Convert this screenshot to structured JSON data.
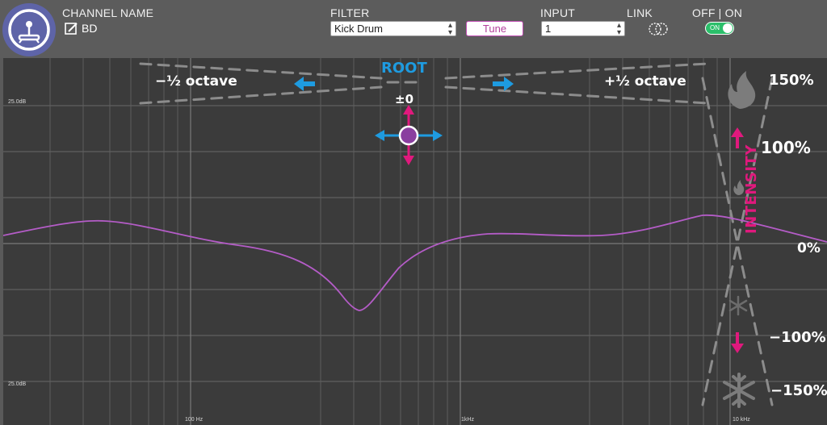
{
  "header": {
    "channel_name_label": "CHANNEL NAME",
    "channel_name_value": "BD",
    "filter_label": "FILTER",
    "filter_value": "Kick Drum",
    "tune_label": "Tune",
    "input_label": "INPUT",
    "input_value": "1",
    "link_label": "LINK",
    "offon_label": "OFF | ON",
    "toggle_text": "ON",
    "toggle_state": "on"
  },
  "graph": {
    "db_top_label": "25.0dB",
    "db_bottom_label": "25.0dB",
    "freq_labels": [
      "100 Hz",
      "1kHz",
      "10 kHz"
    ],
    "root_label": "ROOT",
    "root_value": "±0",
    "minus_octave": "−½ octave",
    "plus_octave": "+½ octave",
    "intensity_label": "INTENSITY",
    "intensity_levels": [
      "150%",
      "100%",
      "0%",
      "−100%",
      "−150%"
    ]
  },
  "colors": {
    "accent_pink": "#e0197d",
    "accent_blue": "#1e9be0",
    "curve_purple": "#b45cc7",
    "logo_bg": "#5e64a8",
    "toggle_on": "#2bbf6a"
  },
  "icons": [
    "drum-logo-icon",
    "edit-icon",
    "link-icon",
    "fire-icon",
    "snowflake-icon",
    "arrow-icon",
    "root-handle-icon"
  ]
}
